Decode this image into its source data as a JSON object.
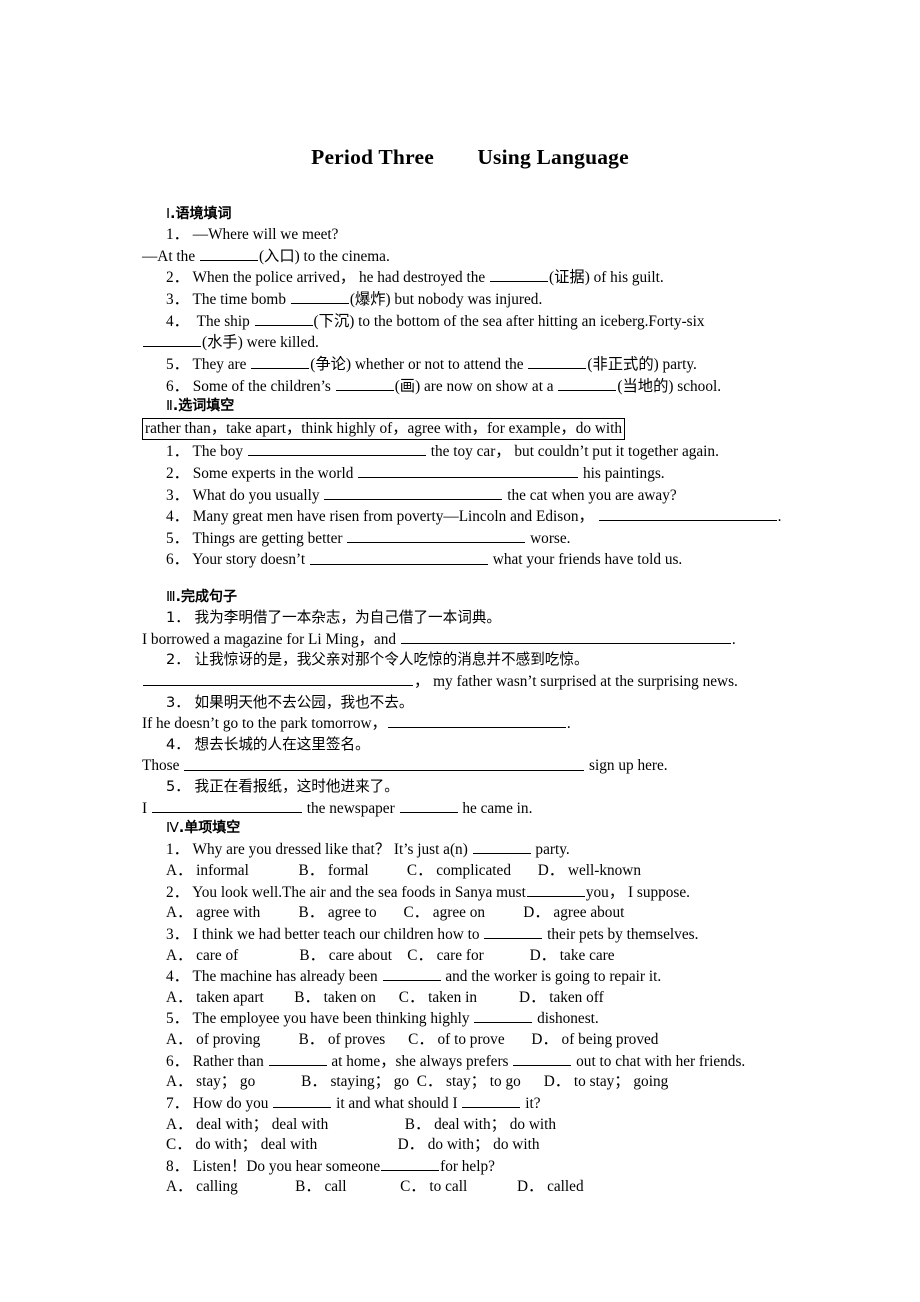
{
  "title": "Period Three　　Using Language",
  "sections": [
    {
      "id": "section-1",
      "heading_roman": "Ⅰ",
      "heading_text": ".语境填词",
      "items": [
        {
          "num": "1．",
          "parts": [
            "—Where will we meet?"
          ]
        },
        {
          "num": "",
          "parts": [
            "—At the ",
            "BLANK_S",
            "(入口) to the cinema."
          ]
        },
        {
          "num": "2．",
          "parts": [
            "When the police arrived， he had destroyed the ",
            "BLANK_S",
            "(证据) of his guilt."
          ]
        },
        {
          "num": "3．",
          "parts": [
            "The time bomb ",
            "BLANK_S",
            "(爆炸) but nobody was injured."
          ]
        },
        {
          "num": "4．",
          "parts": [
            "The ship ",
            "BLANK_S",
            "(下沉) to the bottom of the sea after hitting an iceberg.Forty-six ",
            "BLANK_S",
            "(水手) were killed."
          ]
        },
        {
          "num": "5．",
          "parts": [
            "They are ",
            "BLANK_S",
            "(争论) whether or not to attend the ",
            "BLANK_S",
            "(非正式的) party."
          ]
        },
        {
          "num": "6．",
          "parts": [
            "Some of the children’s ",
            "BLANK_S",
            "(画) are now on show at a ",
            "BLANK_S",
            "(当地的) school."
          ]
        }
      ]
    },
    {
      "id": "section-2",
      "heading_roman": "Ⅱ",
      "heading_text": ".选词填空",
      "word_bank": "rather than，take apart，think highly of，agree with，for example，do with",
      "items": [
        {
          "num": "1．",
          "parts": [
            "The boy ",
            "BLANK_XL",
            " the toy car， but couldn’t put it together again."
          ]
        },
        {
          "num": "2．",
          "parts": [
            "Some experts in the world ",
            "BLANK_XXL",
            " his paintings."
          ]
        },
        {
          "num": "3．",
          "parts": [
            "What do you usually ",
            "BLANK_XL",
            " the cat when you are away?"
          ]
        },
        {
          "num": "4．",
          "parts": [
            "Many great men have risen from poverty—Lincoln and Edison， ",
            "BLANK_XL",
            "."
          ]
        },
        {
          "num": "5．",
          "parts": [
            "Things are getting better ",
            "BLANK_XL",
            " worse."
          ]
        },
        {
          "num": "6．",
          "parts": [
            "Your story doesn’t ",
            "BLANK_XL",
            " what your friends have told us."
          ]
        }
      ]
    },
    {
      "id": "section-3",
      "heading_roman": "Ⅲ",
      "heading_text": ".完成句子",
      "items": [
        {
          "num": "1．",
          "zh": true,
          "parts": [
            "我为李明借了一本杂志，为自己借了一本词典。"
          ]
        },
        {
          "num": "",
          "parts": [
            "I borrowed a magazine for Li Ming，and ",
            "BLANK_WW",
            "."
          ]
        },
        {
          "num": "2．",
          "zh": true,
          "parts": [
            "让我惊讶的是，我父亲对那个令人吃惊的消息并不感到吃惊。"
          ]
        },
        {
          "num": "",
          "indent0": true,
          "parts": [
            "BLANK_W",
            "， my father wasn’t surprised at the surprising news."
          ]
        },
        {
          "num": "3．",
          "zh": true,
          "parts": [
            "如果明天他不去公园，我也不去。"
          ]
        },
        {
          "num": "",
          "parts": [
            "If he doesn’t go to the park tomorrow，",
            "BLANK_XL",
            "."
          ]
        },
        {
          "num": "4．",
          "zh": true,
          "parts": [
            "想去长城的人在这里签名。"
          ]
        },
        {
          "num": "",
          "parts": [
            "Those ",
            "BLANK_WWW",
            " sign up here."
          ]
        },
        {
          "num": "5．",
          "zh": true,
          "parts": [
            "我正在看报纸，这时他进来了。"
          ]
        },
        {
          "num": "",
          "parts": [
            "I ",
            "BLANK_L",
            " the newspaper ",
            "BLANK_S",
            " he came in."
          ]
        }
      ]
    },
    {
      "id": "section-4",
      "heading_roman": "Ⅳ",
      "heading_text": ".单项填空",
      "questions": [
        {
          "num": "1．",
          "parts": [
            "Why are you dressed like that？ It’s just a(n) ",
            "BLANK_S",
            " party."
          ],
          "options": "A． informal             B． formal          C． complicated       D． well-known"
        },
        {
          "num": "2．",
          "parts": [
            "You look well.The air and the sea foods in Sanya must",
            "BLANK_S",
            "you， I suppose."
          ],
          "options": "A． agree with          B． agree to       C． agree on          D． agree about"
        },
        {
          "num": "3．",
          "parts": [
            "I think we had better teach our children how to ",
            "BLANK_S",
            " their pets by themselves."
          ],
          "options": "A． care of                B． care about    C． care for            D． take care"
        },
        {
          "num": "4．",
          "parts": [
            "The machine has already been ",
            "BLANK_S",
            " and the worker is going to repair it."
          ],
          "options": "A． taken apart        B． taken on      C． taken in           D． taken off"
        },
        {
          "num": "5．",
          "parts": [
            "The employee you have been thinking highly ",
            "BLANK_S",
            " dishonest."
          ],
          "options": "A． of proving          B． of proves      C． of to prove       D． of being proved"
        },
        {
          "num": "6．",
          "parts": [
            "Rather than ",
            "BLANK_S",
            " at home，she always prefers ",
            "BLANK_S",
            " out to chat with her friends."
          ],
          "options": "A． stay； go            B． staying； go  C． stay； to go      D． to stay； going"
        },
        {
          "num": "7．",
          "parts": [
            "How do you ",
            "BLANK_S",
            " it and what should I ",
            "BLANK_S",
            " it?"
          ],
          "options": "A． deal with； deal with                    B． deal with； do with",
          "options2": "C． do with； deal with                     D． do with； do with"
        },
        {
          "num": "8．",
          "parts": [
            "Listen！Do you hear someone",
            "BLANK_S",
            "for help?"
          ],
          "options": "A． calling               B． call              C． to call             D． called"
        }
      ]
    }
  ]
}
